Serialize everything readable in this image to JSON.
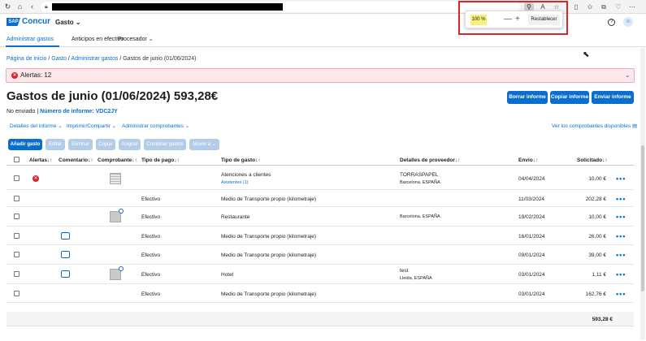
{
  "browser": {
    "zoom_level": "100 %",
    "zoom_minus": "—",
    "zoom_plus": "+",
    "zoom_reset": "Restablecer"
  },
  "app": {
    "logo_sap": "SAP",
    "logo_concur": "Concur",
    "module": "Gasto",
    "help": "?",
    "user": "☺"
  },
  "subnav": [
    "Administrar gastos",
    "Anticipos en efectivo",
    "Procesador"
  ],
  "breadcrumb": [
    "Página de inicio",
    "Gasto",
    "Administrar gastos"
  ],
  "breadcrumb_current": "Gastos de junio (01/06/2024)",
  "breadcrumb_sep": " / ",
  "alert": {
    "text": "Alertas: 12"
  },
  "report": {
    "title": "Gastos de junio (01/06/2024) 593,28€",
    "status": "No enviado",
    "status_sep": " | ",
    "number": "Número de informe: VDC2JY",
    "buttons": [
      "Borrar informe",
      "Copiar informe",
      "Enviar informe"
    ]
  },
  "actions": [
    "Detalles del informe",
    "Imprimir/Compartir",
    "Administrar comprobantes"
  ],
  "view_receipts": "Ver los comprobantes disponibles",
  "toolbar": [
    "Añadir gasto",
    "Editar",
    "Eliminar",
    "Copiar",
    "Asignar",
    "Combinar gastos",
    "Mover a"
  ],
  "columns": {
    "alerts": "Alertas",
    "comment": "Comentario",
    "receipt": "Comprobante",
    "payment": "Tipo de pago",
    "expense_type": "Tipo de gasto",
    "vendor": "Detalles de proveedor",
    "date": "Envío",
    "amount": "Solicitado"
  },
  "rows": [
    {
      "alert": true,
      "comment": false,
      "receipt": "grid",
      "payment": "",
      "type": "Atenciones a clientes",
      "type_sub": "Asistentes (1)",
      "vendor": "TORRASPAPEL",
      "vendor_sub": "Barcelona, ESPAÑA",
      "date": "04/04/2024",
      "amount": "10,00 €"
    },
    {
      "alert": false,
      "comment": false,
      "receipt": "",
      "payment": "Efectivo",
      "type": "Medio de Transporte propio (kilometraje)",
      "type_sub": "",
      "vendor": "",
      "vendor_sub": "",
      "date": "11/03/2024",
      "amount": "202,28 €"
    },
    {
      "alert": false,
      "comment": false,
      "receipt": "photo",
      "payment": "Efectivo",
      "type": "Restaurante",
      "type_sub": "",
      "vendor": "",
      "vendor_sub": "Barcelona, ESPAÑA",
      "date": "19/02/2024",
      "amount": "10,00 €"
    },
    {
      "alert": false,
      "comment": true,
      "receipt": "",
      "payment": "Efectivo",
      "type": "Medio de Transporte propio (kilometraje)",
      "type_sub": "",
      "vendor": "",
      "vendor_sub": "",
      "date": "16/01/2024",
      "amount": "26,00 €"
    },
    {
      "alert": false,
      "comment": true,
      "receipt": "",
      "payment": "Efectivo",
      "type": "Medio de Transporte propio (kilometraje)",
      "type_sub": "",
      "vendor": "",
      "vendor_sub": "",
      "date": "09/01/2024",
      "amount": "39,00 €"
    },
    {
      "alert": false,
      "comment": true,
      "receipt": "photo",
      "payment": "Efectivo",
      "type": "Hotel",
      "type_sub": "",
      "vendor": "test",
      "vendor_sub": "Lleida, ESPAÑA",
      "date": "03/01/2024",
      "amount": "1,11 €"
    },
    {
      "alert": false,
      "comment": false,
      "receipt": "",
      "payment": "Efectivo",
      "type": "Medio de Transporte propio (kilometraje)",
      "type_sub": "",
      "vendor": "",
      "vendor_sub": "",
      "date": "03/01/2024",
      "amount": "162,76 €"
    }
  ],
  "total": "593,28 €"
}
